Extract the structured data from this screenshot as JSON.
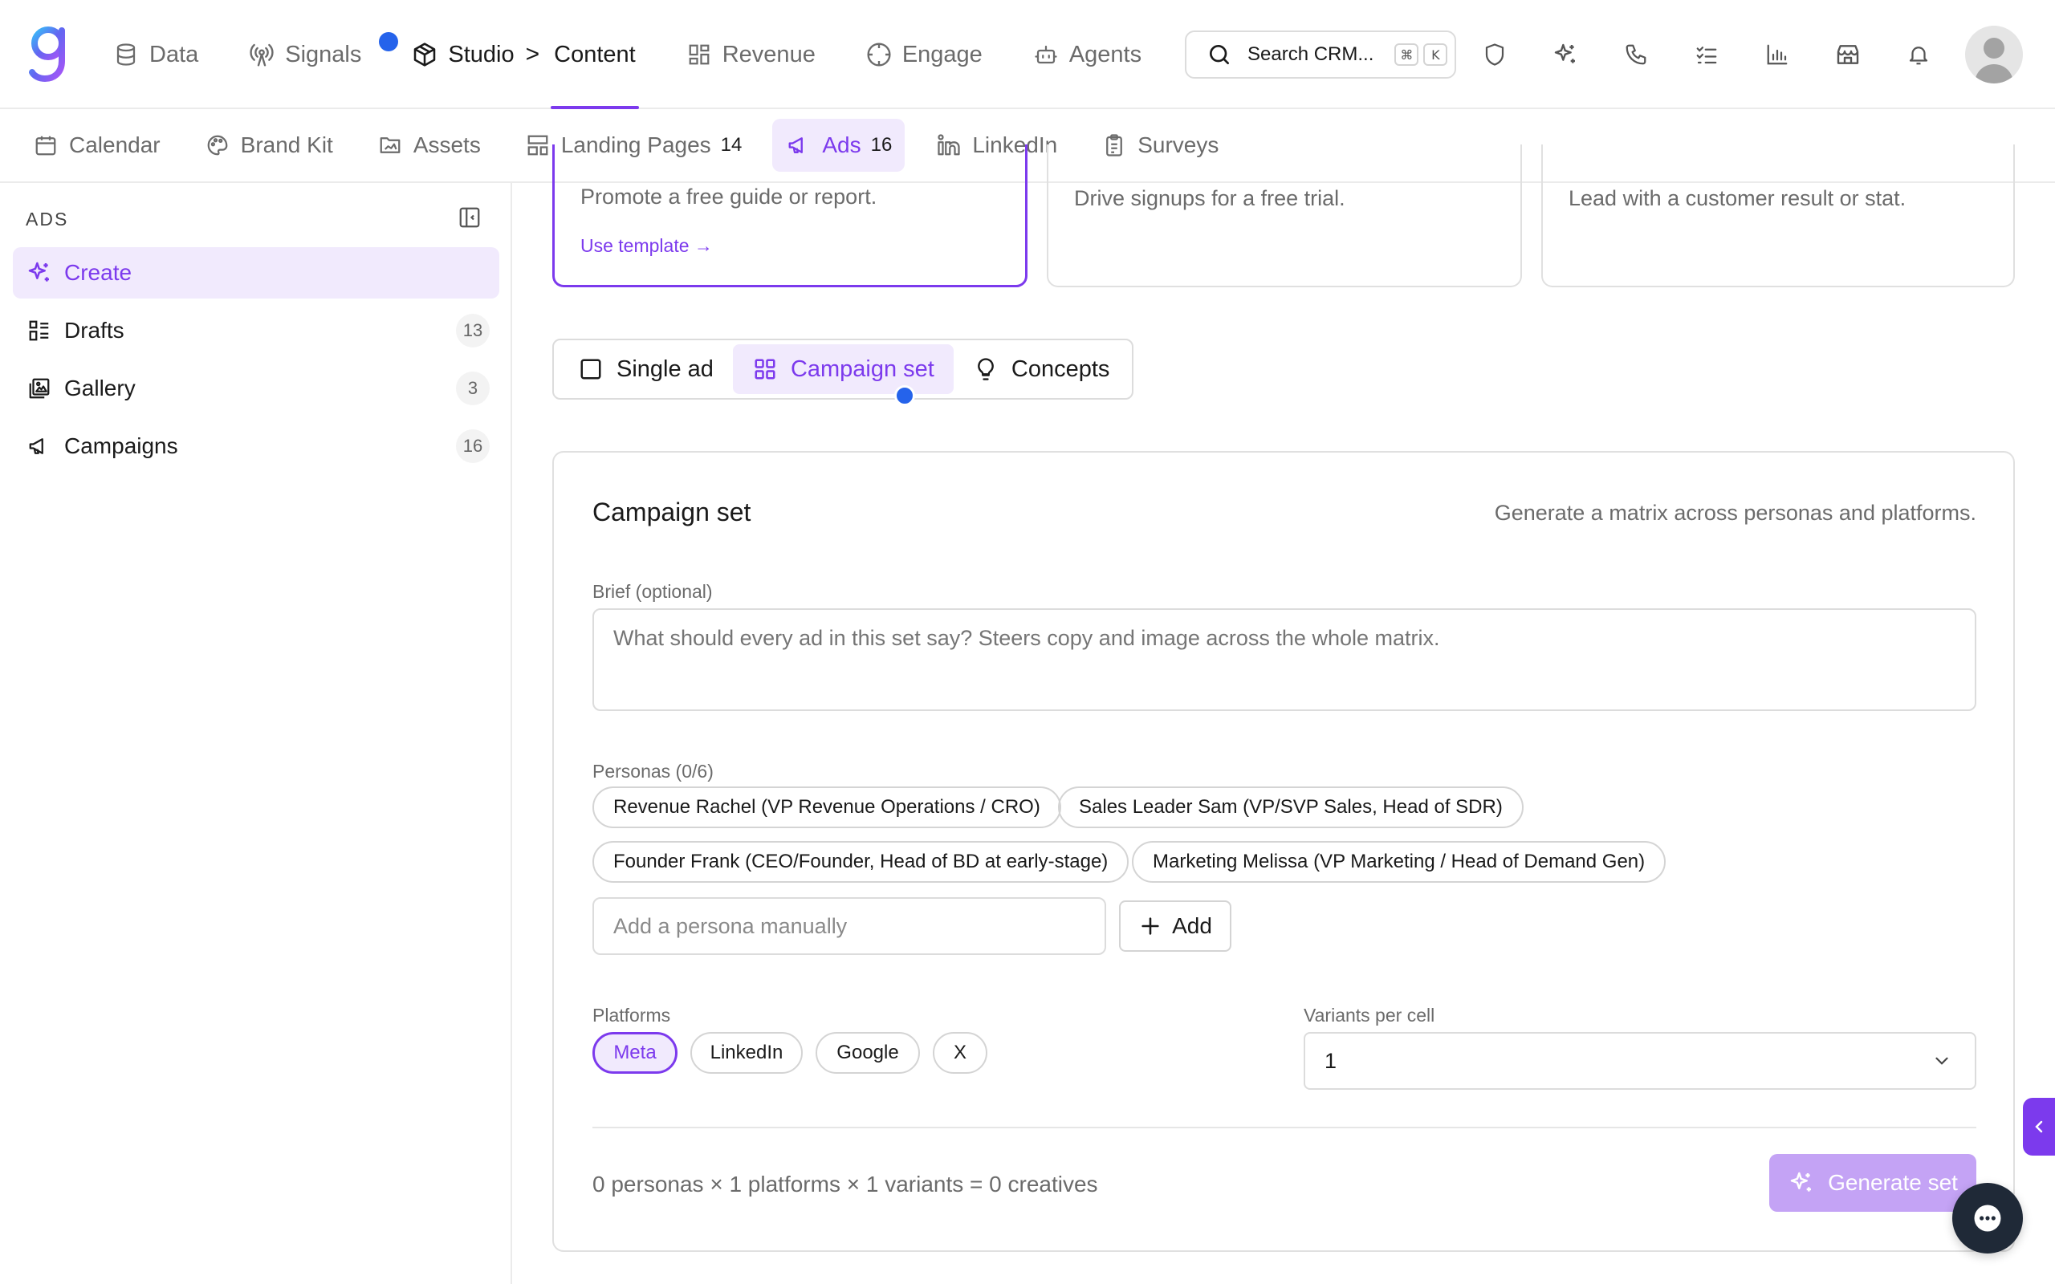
{
  "topnav": {
    "items": [
      {
        "label": "Data",
        "icon": "database-icon"
      },
      {
        "label": "Signals",
        "icon": "broadcast-icon"
      },
      {
        "label": "Studio",
        "icon": "package-icon"
      },
      {
        "label": "Content"
      },
      {
        "label": "Revenue",
        "icon": "grid-icon"
      },
      {
        "label": "Engage",
        "icon": "compass-icon"
      },
      {
        "label": "Agents",
        "icon": "bot-icon"
      }
    ],
    "breadcrumb_separator": ">",
    "search_placeholder": "Search CRM...",
    "search_kbd": [
      "⌘",
      "K"
    ]
  },
  "subnav": {
    "items": [
      {
        "label": "Calendar",
        "count": ""
      },
      {
        "label": "Brand Kit",
        "count": ""
      },
      {
        "label": "Assets",
        "count": ""
      },
      {
        "label": "Landing Pages",
        "count": "14"
      },
      {
        "label": "Ads",
        "count": "16"
      },
      {
        "label": "LinkedIn",
        "count": ""
      },
      {
        "label": "Surveys",
        "count": ""
      }
    ]
  },
  "sidebar": {
    "heading": "ADS",
    "items": [
      {
        "label": "Create",
        "badge": ""
      },
      {
        "label": "Drafts",
        "badge": "13"
      },
      {
        "label": "Gallery",
        "badge": "3"
      },
      {
        "label": "Campaigns",
        "badge": "16"
      }
    ]
  },
  "templates": [
    {
      "desc": "Promote a free guide or report.",
      "link": "Use template →"
    },
    {
      "desc": "Drive signups for a free trial."
    },
    {
      "desc": "Lead with a customer result or stat."
    }
  ],
  "modes": [
    "Single ad",
    "Campaign set",
    "Concepts"
  ],
  "panel": {
    "title": "Campaign set",
    "subtitle": "Generate a matrix across personas and platforms.",
    "brief_label": "Brief (optional)",
    "brief_placeholder": "What should every ad in this set say? Steers copy and image across the whole matrix.",
    "personas_label": "Personas (0/6)",
    "personas": [
      "Revenue Rachel (VP Revenue Operations / CRO)",
      "Sales Leader Sam (VP/SVP Sales, Head of SDR)",
      "Founder Frank (CEO/Founder, Head of BD at early-stage)",
      "Marketing Melissa (VP Marketing / Head of Demand Gen)"
    ],
    "persona_input_placeholder": "Add a persona manually",
    "add_label": "Add",
    "platforms_label": "Platforms",
    "platforms": [
      "Meta",
      "LinkedIn",
      "Google",
      "X"
    ],
    "variants_label": "Variants per cell",
    "variants_value": "1",
    "formula": "0 personas × 1 platforms × 1 variants = 0 creatives",
    "generate_label": "Generate set"
  },
  "colors": {
    "accent": "#7c3aed",
    "accent_bg": "#f1eafd",
    "dot": "#2563eb"
  }
}
